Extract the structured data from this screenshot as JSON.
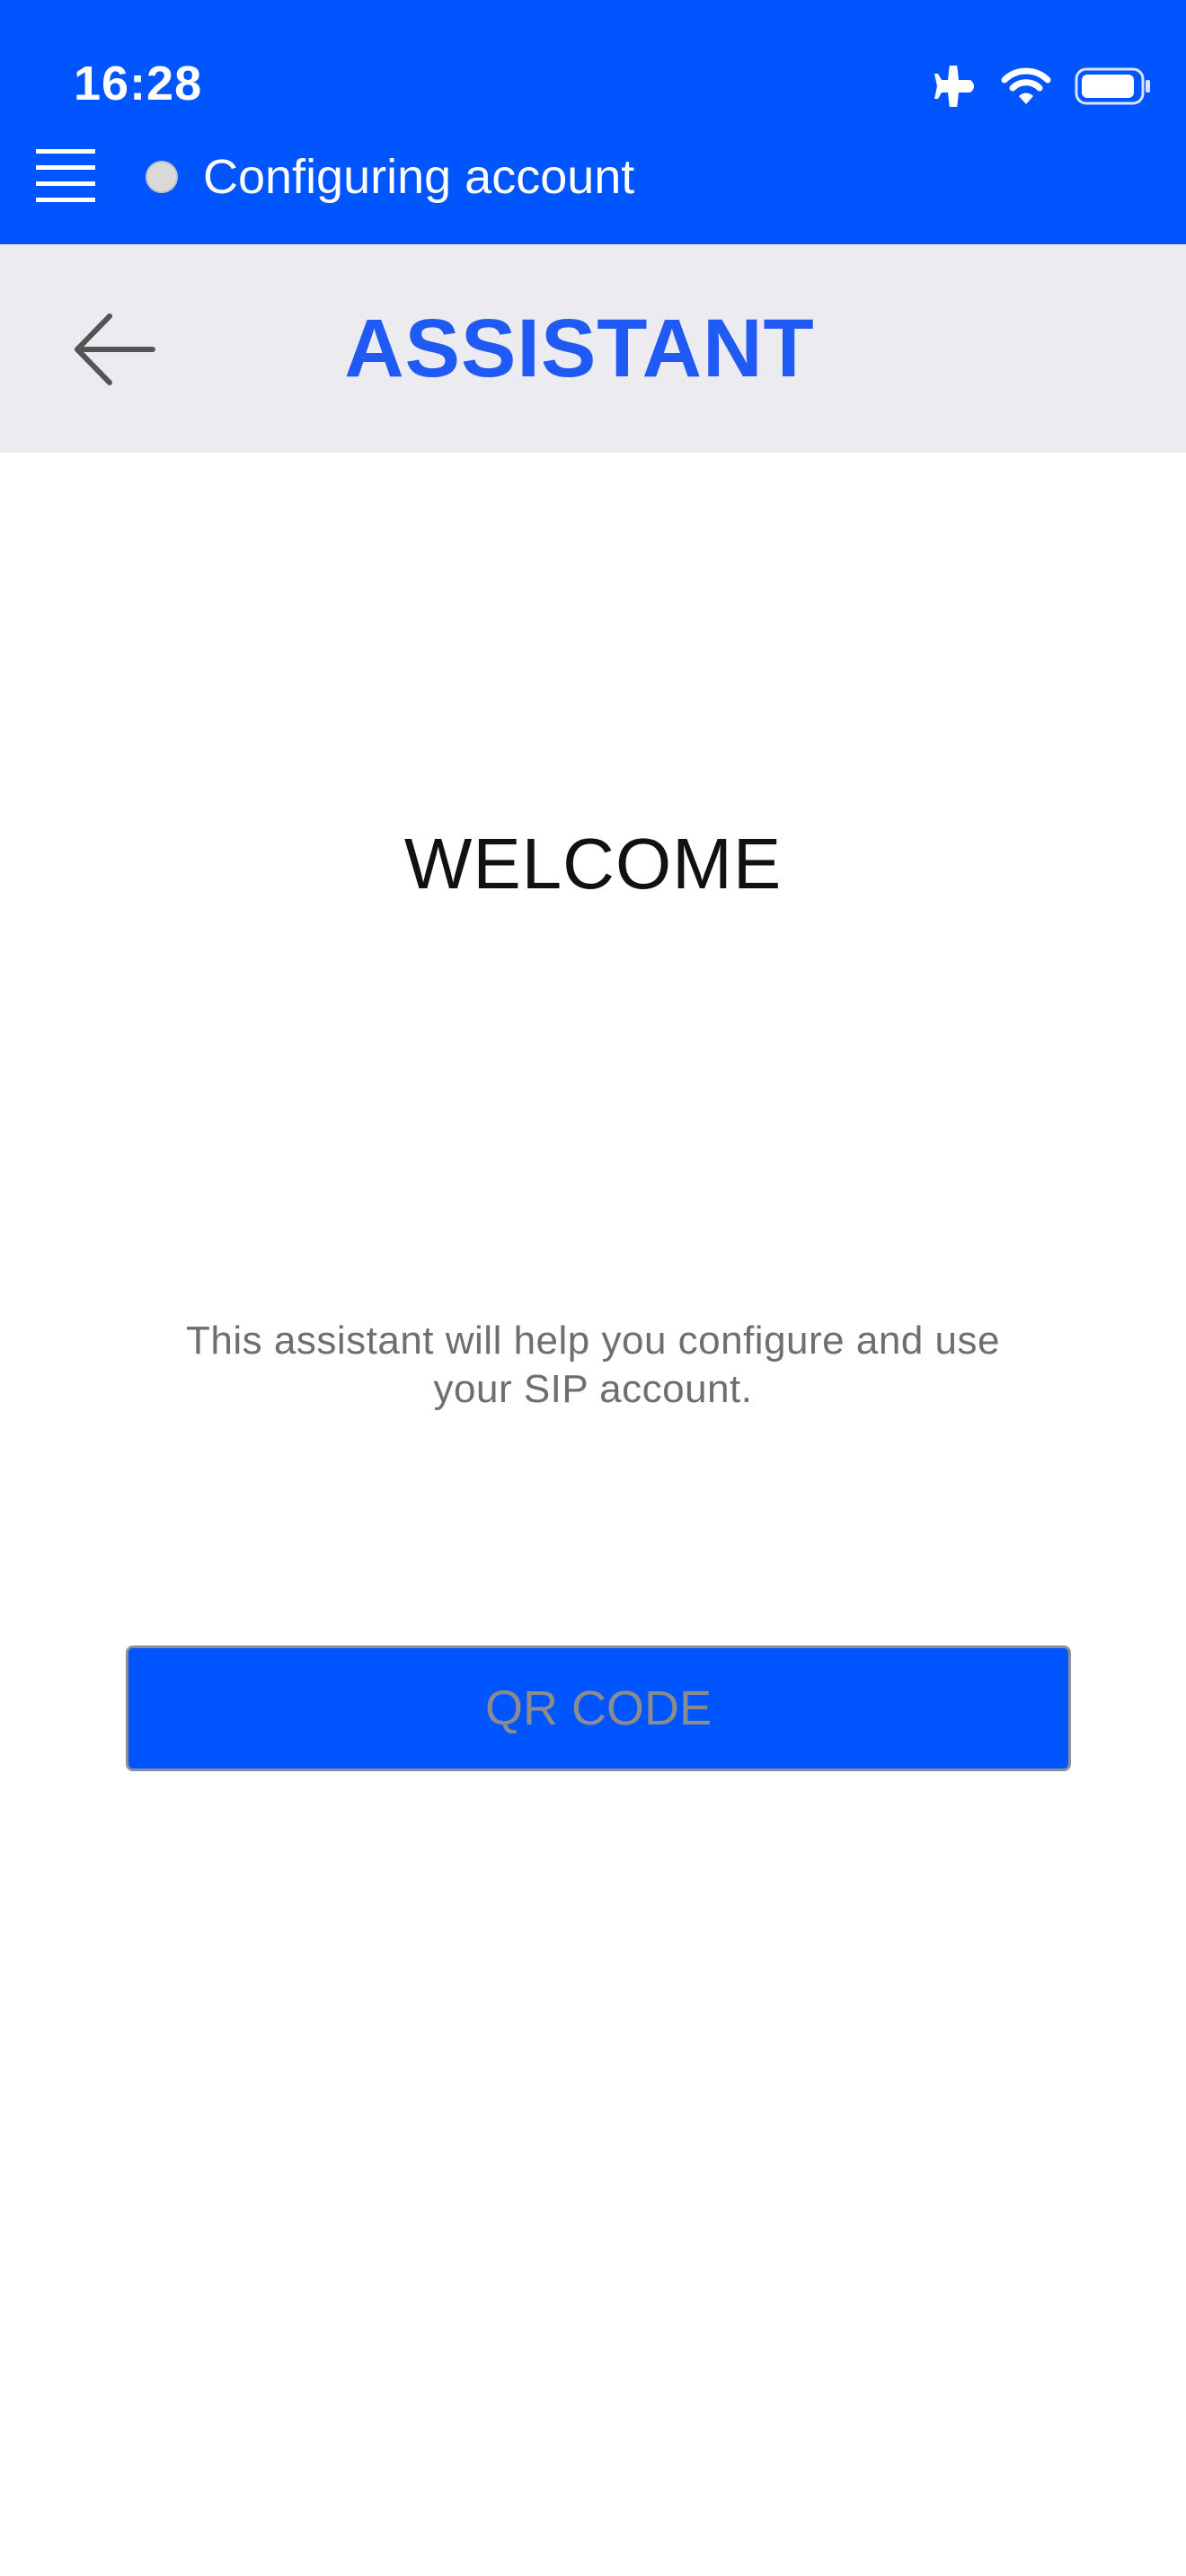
{
  "status_bar": {
    "time": "16:28",
    "icons": [
      "airplane-icon",
      "wifi-icon",
      "battery-icon"
    ]
  },
  "top_bar": {
    "menu_icon": "hamburger-menu-icon",
    "account_status": "Configuring account",
    "account_status_indicator": "gray-dot"
  },
  "header": {
    "back_icon": "arrow-left-icon",
    "title": "ASSISTANT"
  },
  "main": {
    "heading": "WELCOME",
    "description": "This assistant will help you configure and use your SIP account.",
    "qr_button_label": "QR CODE"
  },
  "colors": {
    "brand_blue": "#0055ff",
    "title_blue": "#1f5af5",
    "header_bg": "#ebebf0",
    "muted_text": "#6e6e6e",
    "disabled_button_text": "#8c8c8c"
  }
}
